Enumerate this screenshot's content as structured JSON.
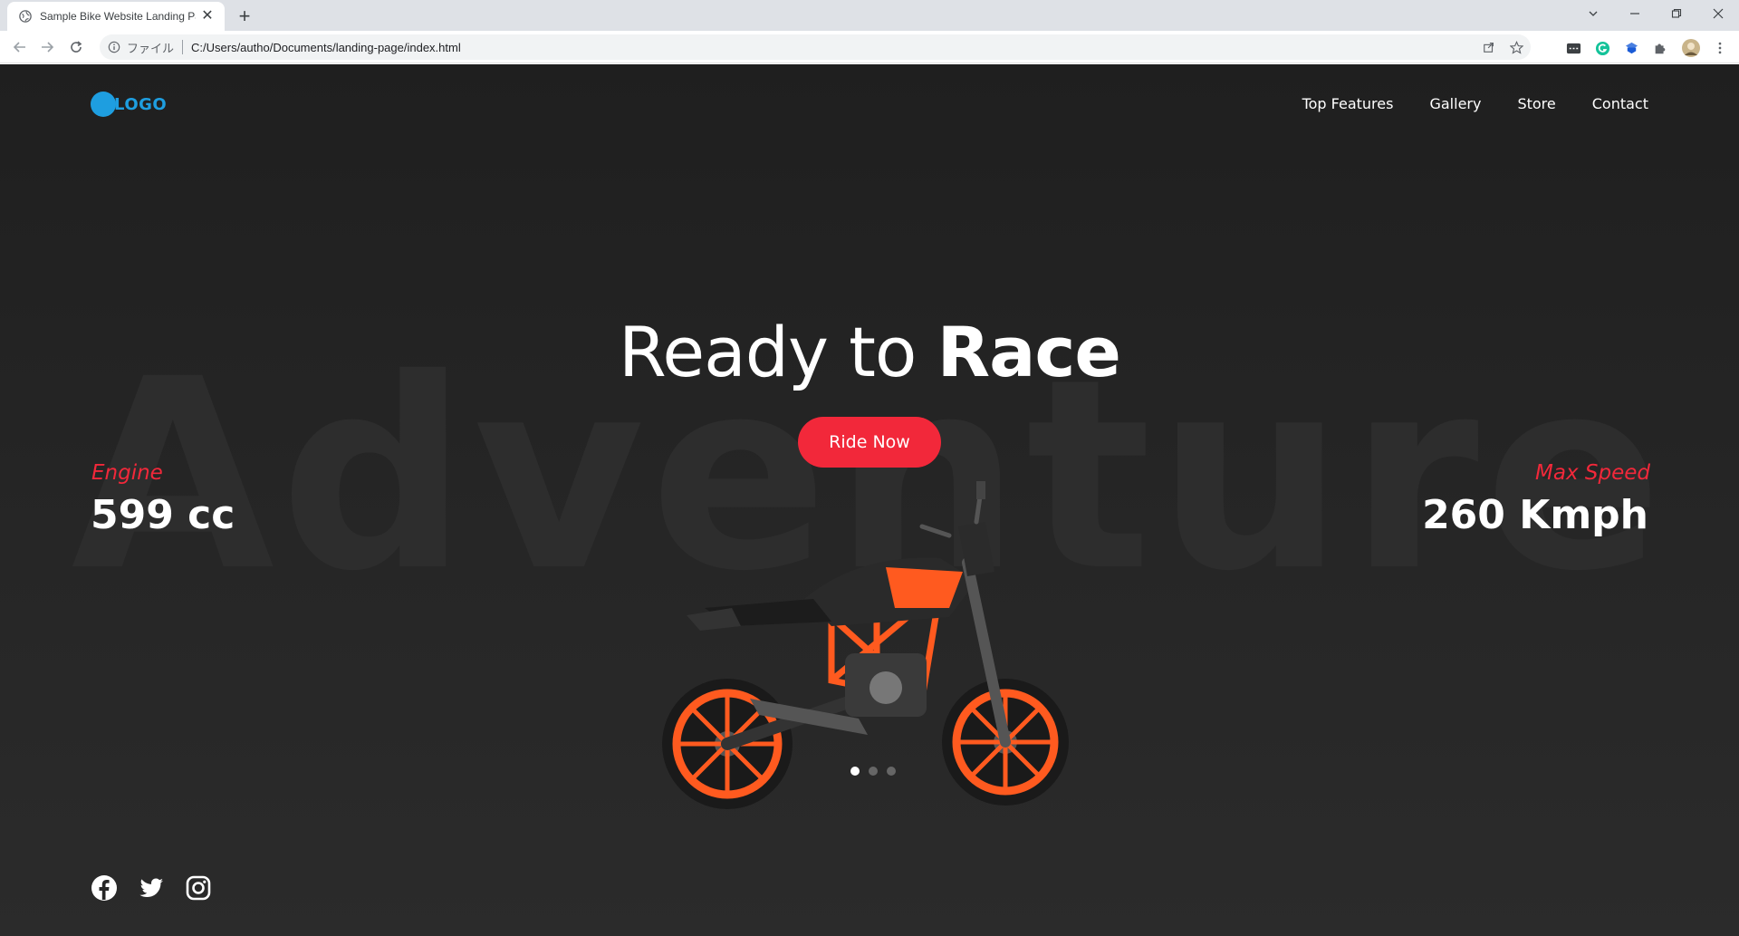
{
  "browser": {
    "tab_title": "Sample Bike Website Landing Pa",
    "scheme_label": "ファイル",
    "url": "C:/Users/autho/Documents/landing-page/index.html"
  },
  "page": {
    "logo_text": "LOGO",
    "nav": [
      "Top Features",
      "Gallery",
      "Store",
      "Contact"
    ],
    "watermark": "Adventure",
    "headline_light": "Ready to ",
    "headline_bold": "Race",
    "cta_label": "Ride Now",
    "stats": {
      "left": {
        "label": "Engine",
        "value": "599 cc"
      },
      "right": {
        "label": "Max Speed",
        "value": "260 Kmph"
      }
    },
    "carousel": {
      "total": 3,
      "active": 1
    },
    "social": [
      "facebook-icon",
      "twitter-icon",
      "instagram-icon"
    ]
  },
  "colors": {
    "accent": "#f2283a",
    "logo": "#1e9ee0",
    "background": "#222222"
  }
}
